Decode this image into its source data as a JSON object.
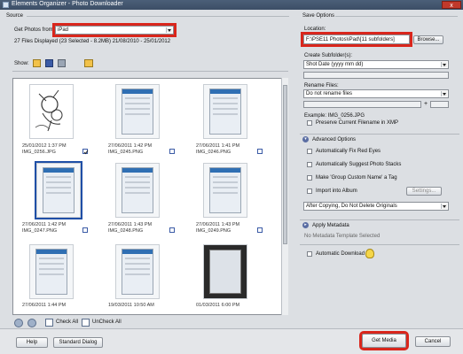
{
  "window": {
    "title": "Elements Organizer - Photo Downloader",
    "close_label": "x"
  },
  "source": {
    "group_label": "Source",
    "get_photos_label": "Get Photos from:",
    "device_value": "iPad",
    "files_info": "27 Files Displayed (23 Selected - 8.2MB) 21/08/2010 - 25/01/2012",
    "show_label": "Show:",
    "rotate_left_icon": "rotate-left-icon",
    "rotate_right_icon": "rotate-right-icon",
    "check_all_label": "Check All",
    "uncheck_all_label": "UnCheck All"
  },
  "thumbnails": [
    {
      "date": "25/01/2012 1:37 PM",
      "name": "IMG_0256.JPG",
      "checked": true,
      "selected": false,
      "kind": "sketch"
    },
    {
      "date": "27/06/2011 1:42 PM",
      "name": "IMG_0245.PNG",
      "checked": false,
      "selected": false,
      "kind": "screen"
    },
    {
      "date": "27/06/2011 1:41 PM",
      "name": "IMG_0246.PNG",
      "checked": false,
      "selected": false,
      "kind": "screen"
    },
    {
      "date": "27/06/2011 1:42 PM",
      "name": "IMG_0247.PNG",
      "checked": false,
      "selected": true,
      "kind": "screen"
    },
    {
      "date": "27/06/2011 1:43 PM",
      "name": "IMG_0248.PNG",
      "checked": false,
      "selected": false,
      "kind": "screen"
    },
    {
      "date": "27/06/2011 1:43 PM",
      "name": "IMG_0249.PNG",
      "checked": false,
      "selected": false,
      "kind": "screen"
    },
    {
      "date": "27/06/2011 1:44 PM",
      "name": "",
      "checked": false,
      "selected": false,
      "kind": "screen"
    },
    {
      "date": "19/03/2011 10:50 AM",
      "name": "",
      "checked": false,
      "selected": false,
      "kind": "screen"
    },
    {
      "date": "01/03/2011 6:00 PM",
      "name": "",
      "checked": false,
      "selected": false,
      "kind": "photo"
    }
  ],
  "save_options": {
    "group_label": "Save Options",
    "location_label": "Location:",
    "location_value": "F:\\PSE11 Photos\\iPad\\[11 subfolders]",
    "browse_label": "Browse...",
    "create_subfolders_label": "Create Subfolder(s):",
    "create_subfolders_value": "Shot Date (yyyy mm dd)",
    "rename_files_label": "Rename Files:",
    "rename_files_value": "Do not rename files",
    "plus_label": "+",
    "example_label": "Example: IMG_0256.JPG",
    "preserve_label": "Preserve Current Filename in XMP"
  },
  "advanced": {
    "header": "Advanced Options",
    "fix_red_eyes": "Automatically Fix Red Eyes",
    "suggest_stacks": "Automatically Suggest Photo Stacks",
    "group_custom_name": "Make 'Group Custom Name' a Tag",
    "import_album": "Import into Album",
    "settings_label": "Settings...",
    "after_copying_value": "After Copying, Do Not Delete Originals"
  },
  "metadata": {
    "header": "Apply Metadata",
    "value": "No Metadata Template Selected"
  },
  "automatic_download": {
    "label": "Automatic Download",
    "icon": "lightbulb-icon"
  },
  "footer": {
    "help_label": "Help",
    "standard_dialog_label": "Standard Dialog",
    "get_media_label": "Get Media",
    "cancel_label": "Cancel"
  }
}
